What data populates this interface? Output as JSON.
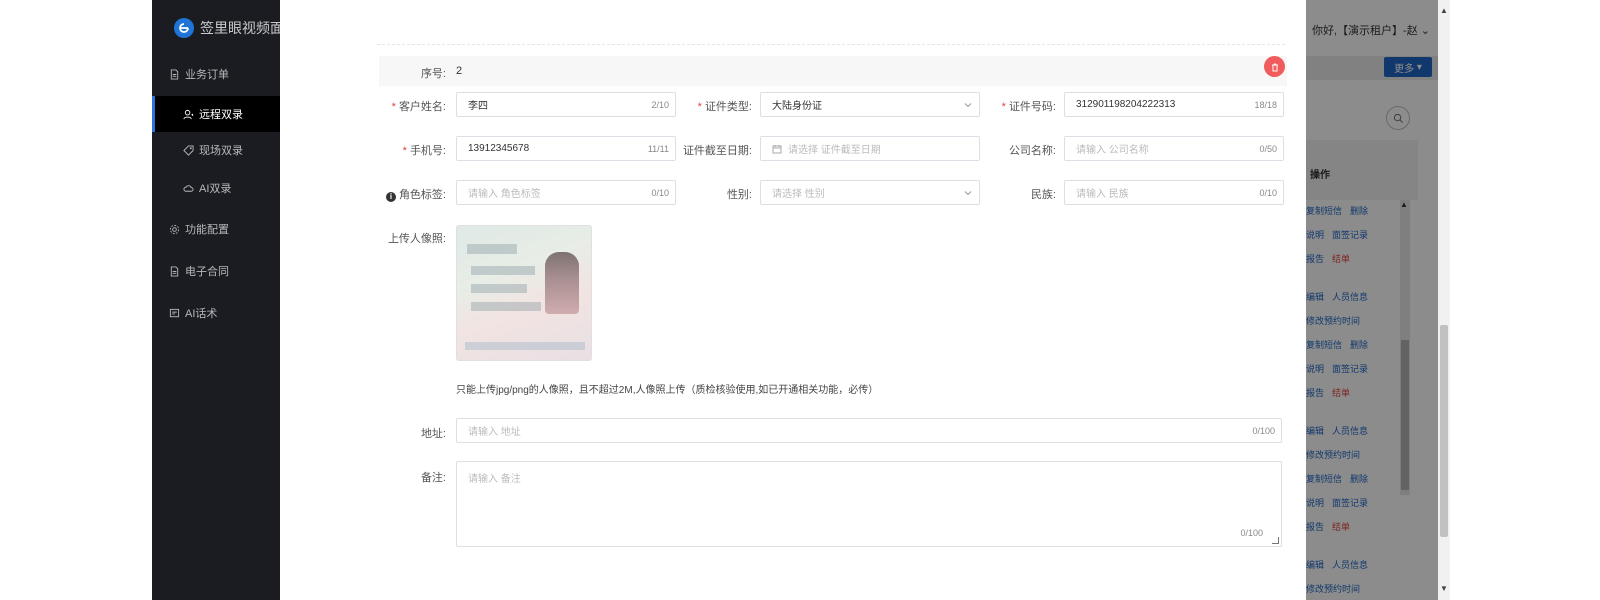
{
  "sidebar": {
    "logo_text": "签里眼视频面签",
    "items": [
      {
        "label": "业务订单",
        "icon": "document-icon"
      },
      {
        "label": "远程双录",
        "icon": "user-video-icon"
      },
      {
        "label": "现场双录",
        "icon": "tag-icon"
      },
      {
        "label": "AI双录",
        "icon": "cloud-icon"
      },
      {
        "label": "功能配置",
        "icon": "gear-icon"
      },
      {
        "label": "电子合同",
        "icon": "document-icon"
      },
      {
        "label": "AI话术",
        "icon": "chat-icon"
      }
    ]
  },
  "background_app": {
    "greeting": "你好,【演示租户】-赵",
    "more_button": "更多",
    "op_column": "操作",
    "op_rows": [
      [
        "复制短信",
        "删除"
      ],
      [
        "说明",
        "面签记录"
      ],
      [
        "报告",
        "结单"
      ],
      [
        "编辑",
        "人员信息"
      ],
      [
        "修改预约时间"
      ],
      [
        "复制短信",
        "删除"
      ],
      [
        "说明",
        "面签记录"
      ],
      [
        "报告",
        "结单"
      ],
      [
        "编辑",
        "人员信息"
      ],
      [
        "修改预约时间"
      ],
      [
        "复制短信",
        "删除"
      ],
      [
        "说明",
        "面签记录"
      ],
      [
        "报告",
        "结单"
      ],
      [
        "编辑",
        "人员信息"
      ],
      [
        "修改预约时间"
      ]
    ]
  },
  "form": {
    "seq_label": "序号:",
    "seq_value": "2",
    "customer_name": {
      "label": "客户姓名:",
      "value": "李四",
      "count": "2/10"
    },
    "id_type": {
      "label": "证件类型:",
      "value": "大陆身份证"
    },
    "id_number": {
      "label": "证件号码:",
      "value": "312901198204222313",
      "count": "18/18"
    },
    "phone": {
      "label": "手机号:",
      "value": "13912345678",
      "count": "11/11"
    },
    "id_expiry": {
      "label": "证件截至日期:",
      "placeholder": "请选择 证件截至日期"
    },
    "company": {
      "label": "公司名称:",
      "placeholder": "请输入 公司名称",
      "count": "0/50"
    },
    "role_tag": {
      "label": "角色标签:",
      "placeholder": "请输入 角色标签",
      "count": "0/10"
    },
    "gender": {
      "label": "性别:",
      "placeholder": "请选择 性别"
    },
    "ethnicity": {
      "label": "民族:",
      "placeholder": "请输入 民族",
      "count": "0/10"
    },
    "photo_label": "上传人像照:",
    "photo_hint": "只能上传jpg/png的人像照，且不超过2M,人像照上传（质检核验使用,如已开通相关功能，必传）",
    "address": {
      "label": "地址:",
      "placeholder": "请输入 地址",
      "count": "0/100"
    },
    "remark": {
      "label": "备注:",
      "placeholder": "请输入 备注",
      "count": "0/100"
    }
  },
  "colors": {
    "accent": "#1f66c5",
    "danger": "#f25b5b",
    "sidebar_bg": "#1b1c21"
  }
}
